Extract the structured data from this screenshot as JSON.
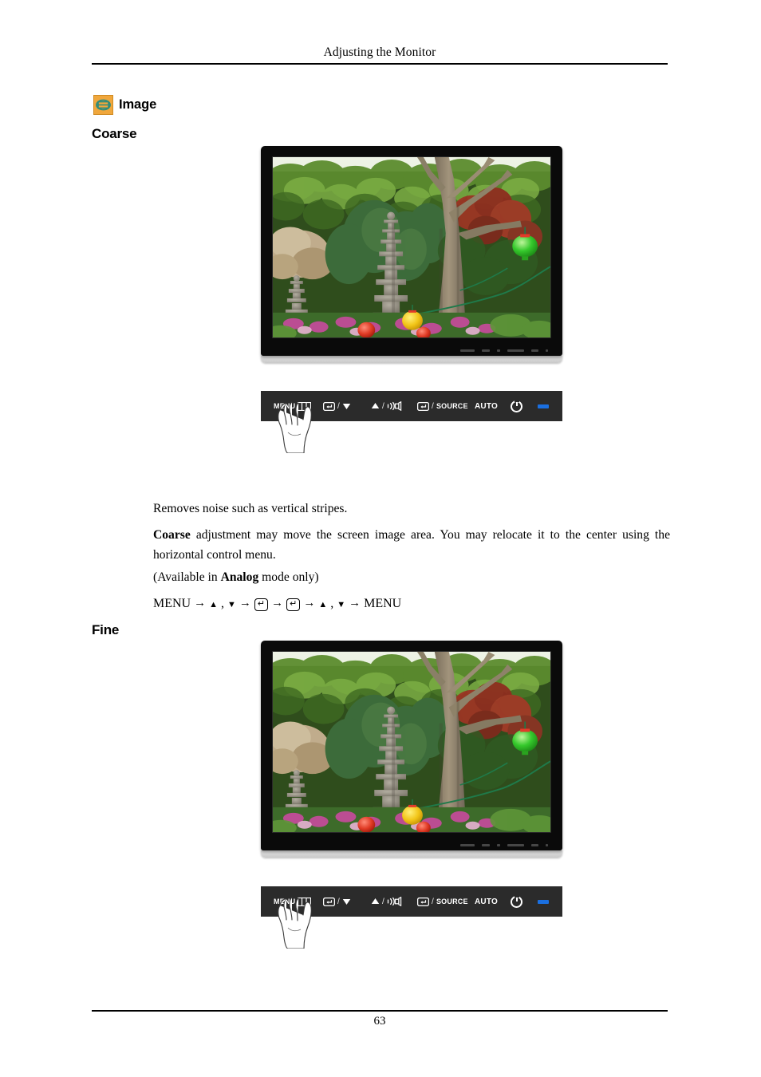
{
  "header": {
    "title": "Adjusting the Monitor"
  },
  "section": {
    "icon_name": "image-settings-icon",
    "icon_bg_color": "#f0a73c",
    "icon_glyph_color": "#2e8b7a",
    "label": "Image"
  },
  "subsections": [
    {
      "id": "coarse",
      "heading": "Coarse"
    },
    {
      "id": "fine",
      "heading": "Fine"
    }
  ],
  "figures": {
    "coarse": {
      "screen_caption": "Korean garden scene with stone pagodas, flowering shrubs and colored paper lanterns",
      "monitor_bezel_color": "#0a0a0a",
      "monitor_base_color": "#d8d8d8"
    },
    "fine": {
      "screen_caption": "Korean garden scene with stone pagodas, flowering shrubs and colored paper lanterns",
      "monitor_bezel_color": "#0a0a0a",
      "monitor_base_color": "#d8d8d8"
    }
  },
  "control_bar": {
    "led_color": "#1a6fe0",
    "background_color": "#2b2b2b",
    "buttons": [
      {
        "name": "menu",
        "label": "MENU",
        "icon": "menu-bars-icon"
      },
      {
        "name": "enter-down",
        "label": "",
        "icon": "enter-key-icon",
        "separator": "/",
        "icon2": "triangle-down-icon"
      },
      {
        "name": "up-volume",
        "label": "",
        "icon": "triangle-up-icon",
        "separator": "/",
        "icon2": "speaker-icon"
      },
      {
        "name": "source",
        "label": "SOURCE",
        "icon": "enter-key-icon",
        "separator": "/"
      },
      {
        "name": "auto",
        "label": "AUTO",
        "icon": ""
      },
      {
        "name": "power",
        "label": "",
        "icon": "power-icon"
      },
      {
        "name": "power-led",
        "label": "",
        "icon": "led-indicator-icon"
      }
    ],
    "hand_overlay": "hand-pressing-menu-illustration"
  },
  "body": {
    "coarse_intro": "Removes noise such as vertical stripes.",
    "coarse_desc_bold": "Coarse",
    "coarse_desc_rest": " adjustment may move the screen image area. You may relocate it to the center using the horizontal control menu.",
    "availability_pre": "(Available in ",
    "availability_bold": "Analog",
    "availability_post": " mode only)",
    "menu_path": {
      "start": "MENU",
      "arrow": "→",
      "up": "▲",
      "comma": ",",
      "down": "▼",
      "enter": "↵",
      "end": "MENU"
    }
  },
  "footer": {
    "page_number": "63"
  }
}
